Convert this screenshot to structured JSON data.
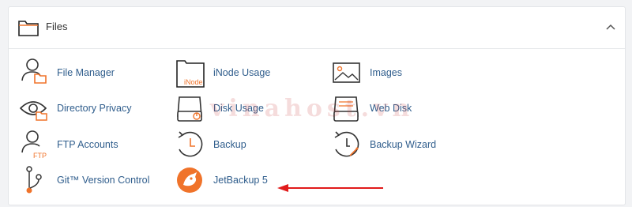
{
  "panel": {
    "title": "Files",
    "folder_icon": "folder-icon",
    "collapse_icon": "chevron-up-icon"
  },
  "items": [
    {
      "label": "File Manager",
      "icon": "file-manager-icon"
    },
    {
      "label": "iNode Usage",
      "icon": "inode-usage-icon",
      "icon_text": "iNode"
    },
    {
      "label": "Images",
      "icon": "images-icon"
    },
    {
      "label": "Directory Privacy",
      "icon": "directory-privacy-icon"
    },
    {
      "label": "Disk Usage",
      "icon": "disk-usage-icon"
    },
    {
      "label": "Web Disk",
      "icon": "web-disk-icon"
    },
    {
      "label": "FTP Accounts",
      "icon": "ftp-accounts-icon",
      "icon_text": "FTP"
    },
    {
      "label": "Backup",
      "icon": "backup-icon"
    },
    {
      "label": "Backup Wizard",
      "icon": "backup-wizard-icon"
    },
    {
      "label": "Git™ Version Control",
      "icon": "git-version-control-icon"
    },
    {
      "label": "JetBackup 5",
      "icon": "jetbackup-icon"
    }
  ],
  "watermark": "vinahost.vn",
  "colors": {
    "link": "#2f5d8c",
    "accent": "#f0732a",
    "icon_stroke": "#333333",
    "arrow": "#e11b1b"
  }
}
